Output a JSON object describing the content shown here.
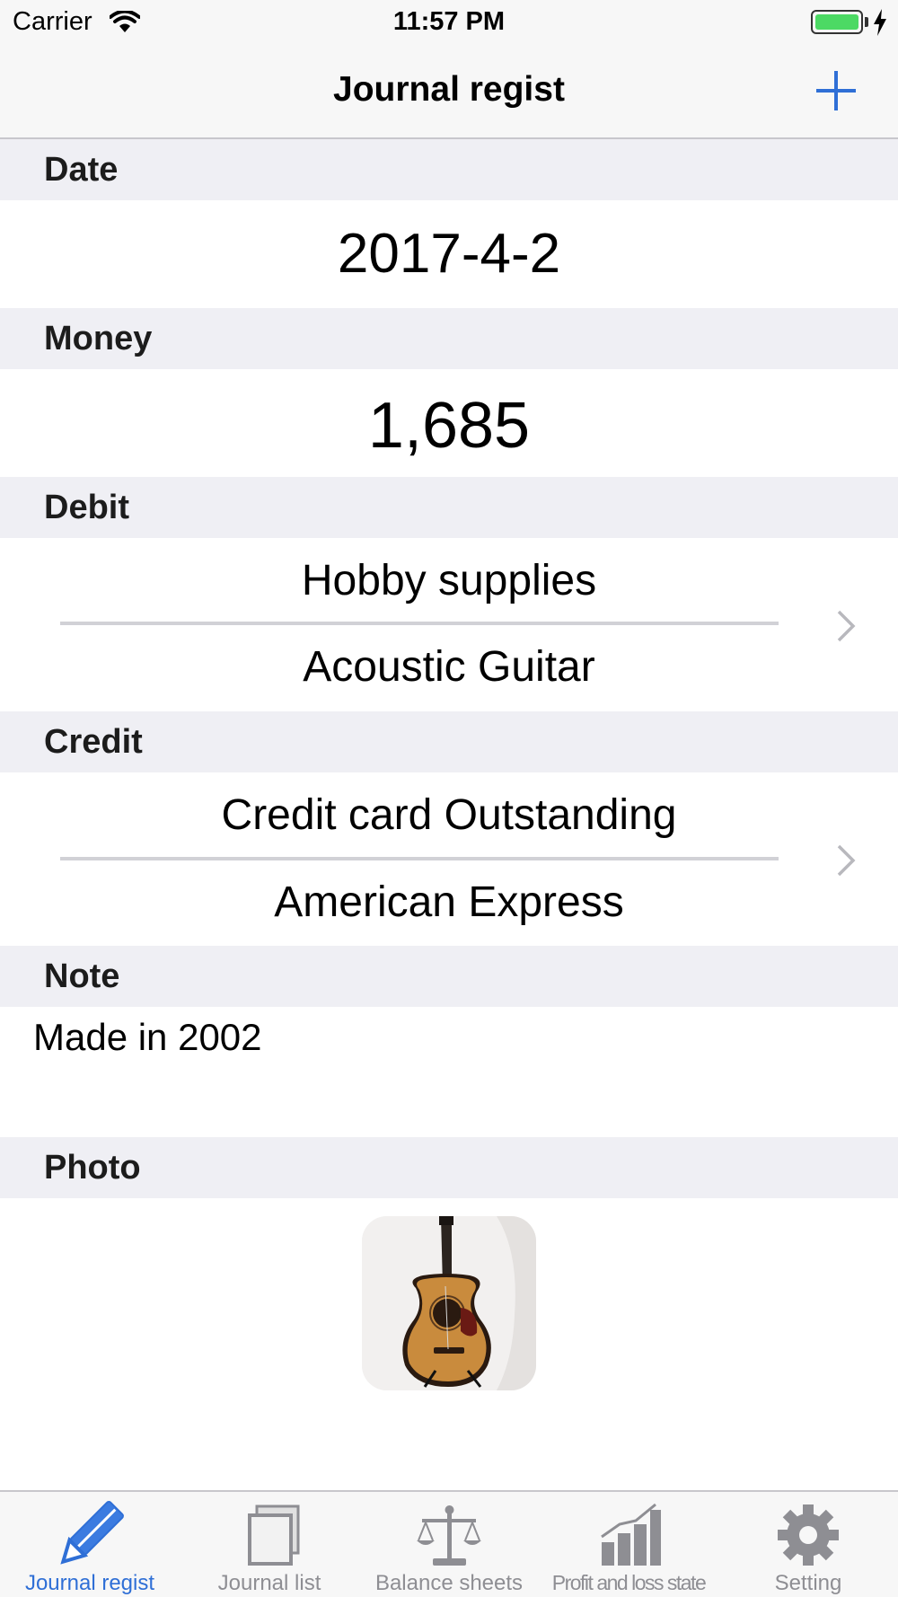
{
  "status_bar": {
    "carrier": "Carrier",
    "time": "11:57 PM",
    "battery_color": "#4cd964"
  },
  "nav": {
    "title": "Journal regist",
    "add_icon": "plus-icon",
    "accent_color": "#2f6fd6"
  },
  "sections": {
    "date": {
      "header": "Date",
      "value": "2017-4-2"
    },
    "money": {
      "header": "Money",
      "value": "1,685"
    },
    "debit": {
      "header": "Debit",
      "account": "Hobby supplies",
      "sub_account": "Acoustic Guitar"
    },
    "credit": {
      "header": "Credit",
      "account": "Credit card Outstanding",
      "sub_account": "American Express"
    },
    "note": {
      "header": "Note",
      "text": "Made in 2002"
    },
    "photo": {
      "header": "Photo",
      "image": "acoustic-guitar-photo"
    }
  },
  "tabs": [
    {
      "label": "Journal regist",
      "icon": "pencil-icon",
      "active": true
    },
    {
      "label": "Journal list",
      "icon": "journal-list-icon",
      "active": false
    },
    {
      "label": "Balance sheets",
      "icon": "scales-icon",
      "active": false
    },
    {
      "label": "Profit and loss state",
      "icon": "bar-chart-icon",
      "active": false
    },
    {
      "label": "Setting",
      "icon": "gear-icon",
      "active": false
    }
  ]
}
